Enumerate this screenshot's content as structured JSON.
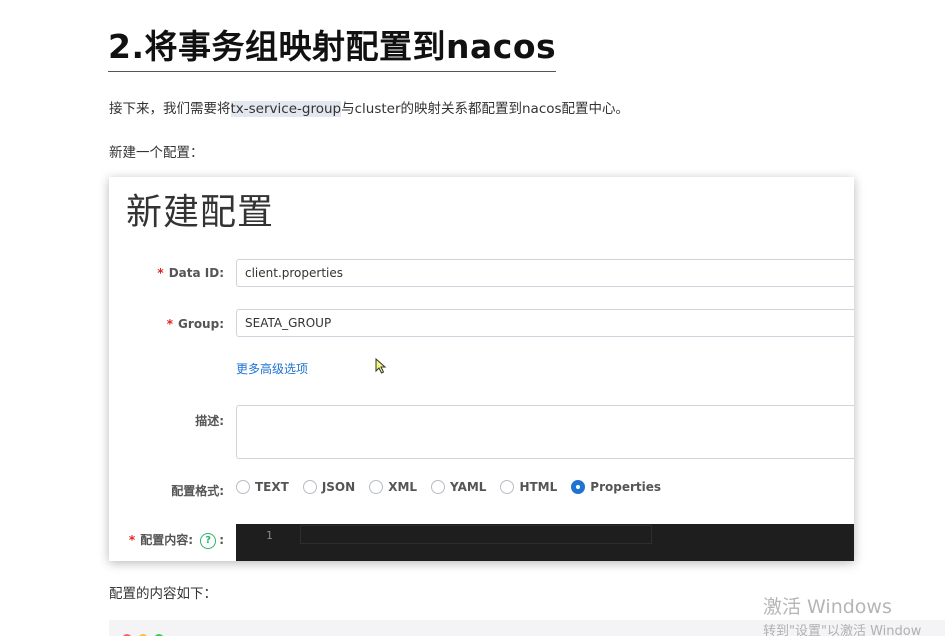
{
  "document": {
    "heading": "2.将事务组映射配置到nacos",
    "intro": {
      "before": "接下来，我们需要将",
      "code": "tx-service-group",
      "after": "与cluster的映射关系都配置到nacos配置中心。"
    },
    "new_config_text": "新建一个配置：",
    "content_text": "配置的内容如下："
  },
  "nacos_form": {
    "title": "新建配置",
    "data_id": {
      "label": "Data ID:",
      "value": "client.properties"
    },
    "group": {
      "label": "Group:",
      "value": "SEATA_GROUP"
    },
    "advanced_link": "更多高级选项",
    "description": {
      "label": "描述:",
      "value": ""
    },
    "format": {
      "label": "配置格式:",
      "options": [
        "TEXT",
        "JSON",
        "XML",
        "YAML",
        "HTML",
        "Properties"
      ],
      "selected": "Properties"
    },
    "content": {
      "label": "配置内容:",
      "help_icon": "?",
      "suffix": ":",
      "line_number": "1"
    },
    "required_mark": "*"
  },
  "watermark": {
    "line1": "激活 Windows",
    "line2": "转到\"设置\"以激活 Window"
  },
  "colors": {
    "accent": "#1f73d1",
    "required": "#e02020",
    "help": "#2bb36a",
    "editor_bg": "#1e1e1e"
  }
}
